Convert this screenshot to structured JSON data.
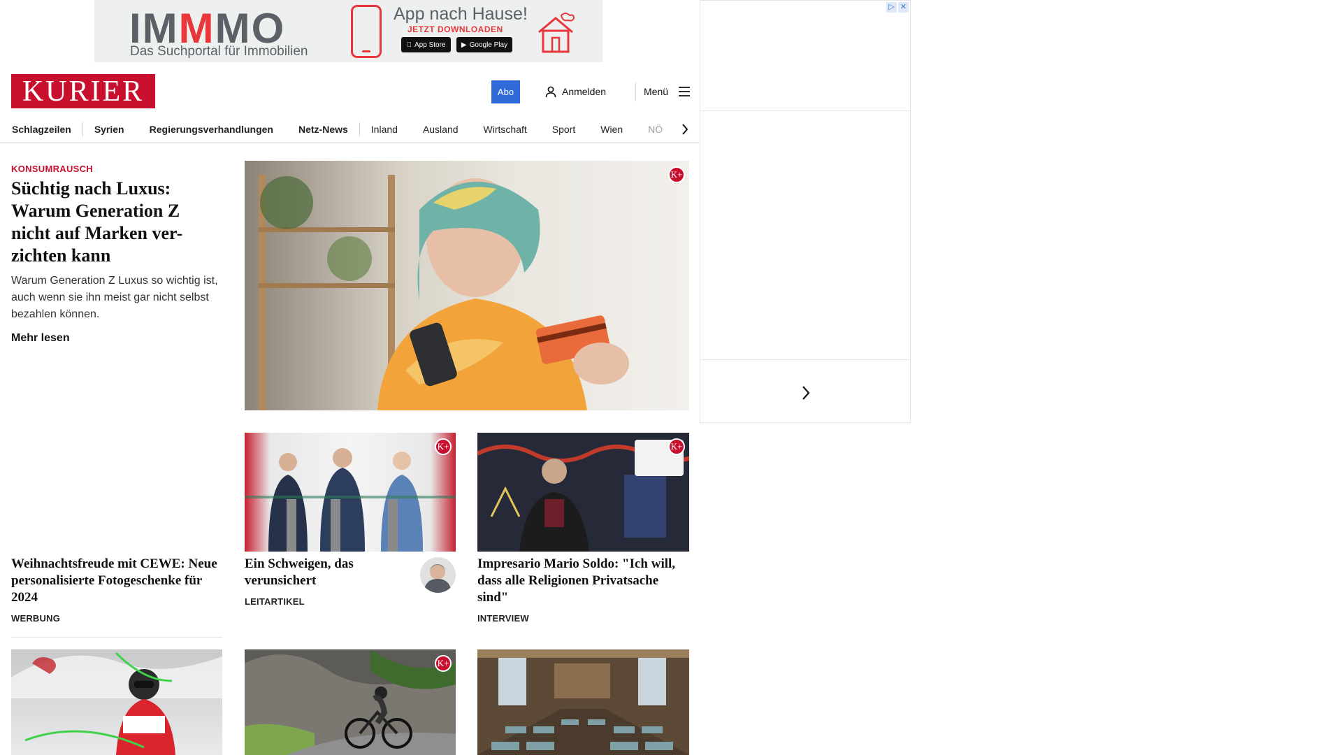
{
  "top_ad": {
    "brand_prefix": "IM",
    "brand_highlight": "M",
    "brand_suffix": "MO",
    "tagline": "Das Suchportal für Immobilien",
    "headline": "App nach Hause!",
    "cta": "JETZT DOWNLOADEN",
    "app_store": "App Store",
    "google_play": "Google Play"
  },
  "header": {
    "logo": "KURIER",
    "abo_label": "Abo",
    "login_label": "Anmelden",
    "menu_label": "Menü"
  },
  "nav": {
    "items": [
      "Schlagzeilen",
      "Syrien",
      "Regierungsverhandlungen",
      "Netz-News",
      "Inland",
      "Ausland",
      "Wirtschaft",
      "Sport",
      "Wien",
      "NÖ"
    ]
  },
  "lead": {
    "kicker": "KONSUMRAUSCH",
    "title": "Süchtig nach Luxus: Warum Generation Z nicht auf Marken ver-zichten kann",
    "teaser": "Warum Generation Z Luxus so wichtig ist, auch wenn sie ihn meist gar nicht selbst bezahlen können.",
    "more": "Mehr lesen",
    "badge": "K+"
  },
  "cards": [
    {
      "title": "Weihnachtsfreude mit CEWE: Neue personalisierte Fotogeschenke für 2024",
      "tag": "WERBUNG"
    },
    {
      "title": "Ein Schweigen, das verunsichert",
      "tag": "LEITARTIKEL",
      "badge": "K+"
    },
    {
      "title": "Impresario Mario Soldo: \"Ich will, dass alle Religionen Privatsache sind\"",
      "tag": "INTERVIEW",
      "badge": "K+"
    }
  ],
  "bottom_cards": [
    {
      "badge": ""
    },
    {
      "badge": "K+"
    },
    {
      "badge": ""
    }
  ],
  "ad_choices": {
    "info": "▷",
    "close": "✕"
  },
  "colors": {
    "brand_red": "#c8102e",
    "abo_blue": "#2e6bd8"
  },
  "icons": [
    "user-icon",
    "hamburger-icon",
    "chevron-right-icon"
  ]
}
